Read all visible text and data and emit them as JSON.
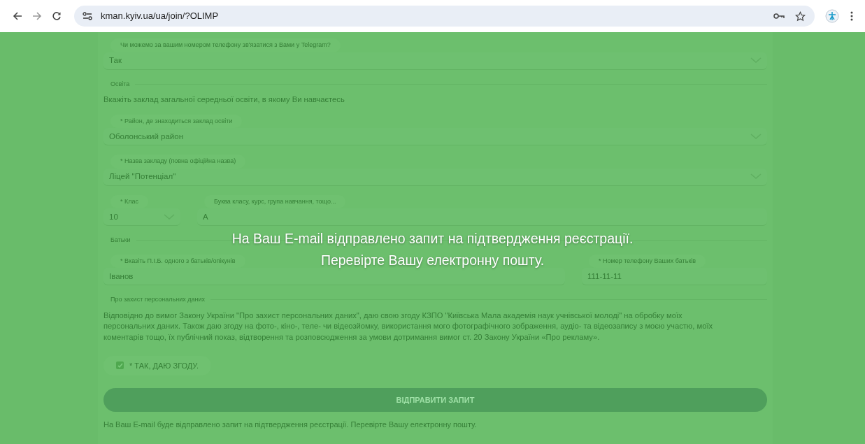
{
  "browser": {
    "url": "kman.kyiv.ua/ua/join/?OLIMP"
  },
  "form": [
    {
      "kind": "select",
      "label": "Чи можемо за вашим номером телефону зв'язатися з Вами у Telegram?",
      "value": "Так"
    },
    {
      "kind": "legend",
      "text": "Освіта"
    },
    {
      "kind": "text",
      "text": "Вкажіть заклад загальної середньої освіти, в якому Ви навчаєтесь"
    },
    {
      "kind": "select",
      "label": "* Район, де знаходиться заклад освіти",
      "value": "Оболонський район"
    },
    {
      "kind": "select",
      "label": "* Назва закладу (повна офіційна назва)",
      "value": "Ліцей \"Потенціал\""
    },
    {
      "kind": "row",
      "fields": [
        {
          "kind": "select",
          "label": "* Клас",
          "value": "10"
        },
        {
          "kind": "input",
          "label": "Буква класу, курс, група навчання, тощо...",
          "value": "А"
        }
      ]
    },
    {
      "kind": "legend",
      "text": "Батьки"
    },
    {
      "kind": "row",
      "fields": [
        {
          "kind": "input",
          "label": "* Вказіть П.І.Б. одного з батьків/опікунів",
          "value": "Іванов"
        },
        {
          "kind": "input",
          "label": "* Номер телефону Ваших батьків",
          "value": "111-11-11"
        }
      ]
    },
    {
      "kind": "legend",
      "text": "Про захист персональних даних"
    },
    {
      "kind": "text",
      "text": "Відповідно до вимог Закону України \"Про захист персональних даних\", даю свою згоду КЗПО \"Київська Мала академія наук учнівської молоді\" на обробку моїх персональних даних. Також даю згоду на фото-, кіно-, теле- чи відеозйомку, використання мого фотографічного зображення, аудіо- та відеозапису з моєю участю, моїх коментарів тощо, їх публічний показ, відтворення та розповсюдження за умови дотримання вимог ст. 20 Закону України «Про рекламу»."
    },
    {
      "kind": "checkbox",
      "label": "* ТАК, ДАЮ ЗГОДУ.",
      "checked": true
    },
    {
      "kind": "button",
      "label": "ВІДПРАВИТИ ЗАПИТ"
    },
    {
      "kind": "note",
      "text": "На Ваш E-mail буде відправлено запит на підтвердження реєстрації. Перевірте Вашу електронну пошту."
    }
  ],
  "message": {
    "lines": [
      "На Ваш E-mail відправлено запит на підтвердження реєстрації.",
      "Перевірте Вашу електронну пошту."
    ]
  }
}
